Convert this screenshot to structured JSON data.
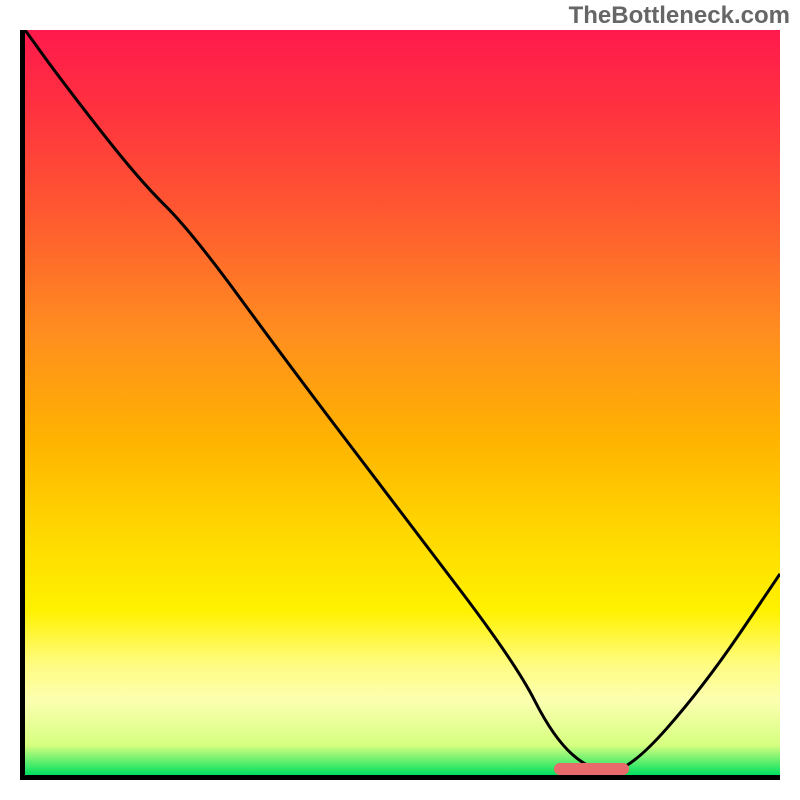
{
  "watermark": "TheBottleneck.com",
  "chart_data": {
    "type": "line",
    "title": "",
    "xlabel": "",
    "ylabel": "",
    "xlim": [
      0,
      100
    ],
    "ylim": [
      0,
      100
    ],
    "grid": false,
    "x": [
      0,
      5,
      15,
      22,
      35,
      50,
      65,
      70,
      75,
      80,
      90,
      100
    ],
    "values": [
      100,
      93,
      80,
      73,
      55,
      35,
      15,
      5,
      0.5,
      0.5,
      12,
      27
    ],
    "highlight_range": [
      70,
      80
    ],
    "background_gradient": {
      "stops": [
        {
          "pos": 0,
          "color": "#ff1a4d"
        },
        {
          "pos": 25,
          "color": "#ff5a30"
        },
        {
          "pos": 55,
          "color": "#ffb300"
        },
        {
          "pos": 78,
          "color": "#fff200"
        },
        {
          "pos": 96,
          "color": "#d6ff80"
        },
        {
          "pos": 100,
          "color": "#00e060"
        }
      ]
    },
    "curve_color": "#000000",
    "highlight_color": "#e96a6a"
  }
}
